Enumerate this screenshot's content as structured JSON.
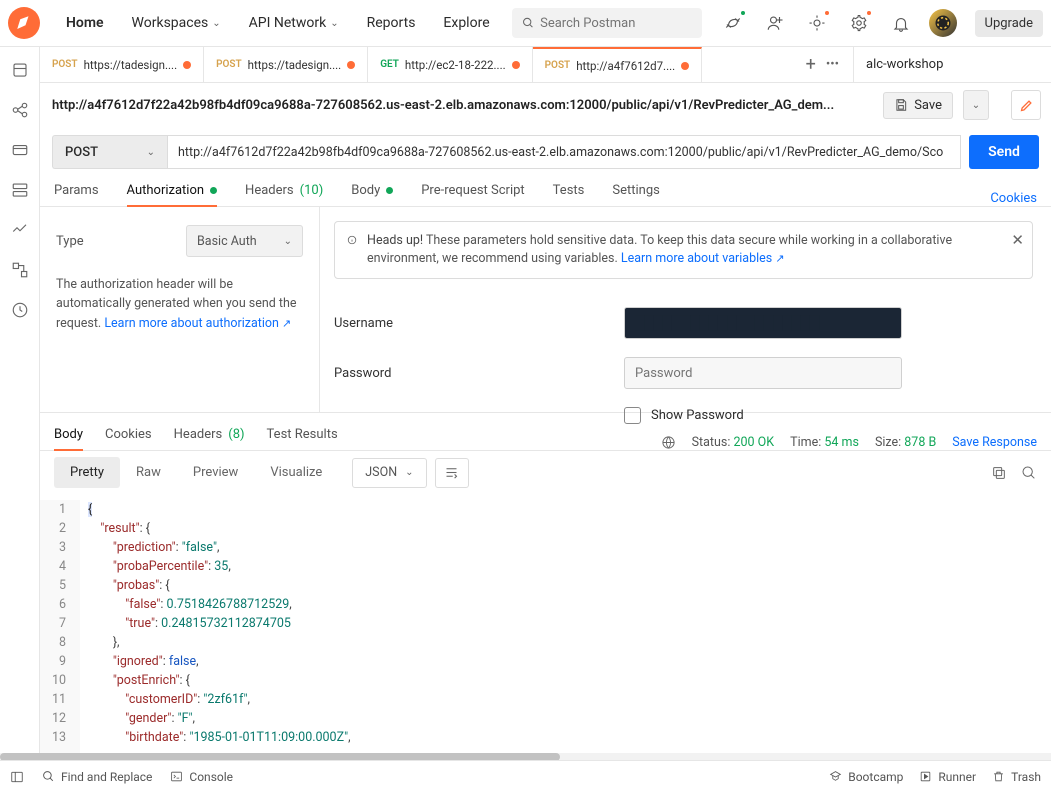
{
  "nav": {
    "home": "Home",
    "workspaces": "Workspaces",
    "apinetwork": "API Network",
    "reports": "Reports",
    "explore": "Explore",
    "search_placeholder": "Search Postman",
    "upgrade": "Upgrade"
  },
  "tabs": [
    {
      "method": "POST",
      "title": "https://tadesign....",
      "dirty": true
    },
    {
      "method": "POST",
      "title": "https://tadesign....",
      "dirty": true
    },
    {
      "method": "GET",
      "title": "http://ec2-18-222....",
      "dirty": true
    },
    {
      "method": "POST",
      "title": "http://a4f7612d7....",
      "dirty": true,
      "active": true
    }
  ],
  "environment": "alc-workshop",
  "request": {
    "breadcrumb": "http://a4f7612d7f22a42b98fb4df09ca9688a-727608562.us-east-2.elb.amazonaws.com:12000/public/api/v1/RevPredicter_AG_dem...",
    "method": "POST",
    "url": "http://a4f7612d7f22a42b98fb4df09ca9688a-727608562.us-east-2.elb.amazonaws.com:12000/public/api/v1/RevPredicter_AG_demo/Sco",
    "save": "Save",
    "send": "Send"
  },
  "reqtabs": {
    "params": "Params",
    "authorization": "Authorization",
    "headers": "Headers",
    "headers_count": "(10)",
    "body": "Body",
    "prereq": "Pre-request Script",
    "tests": "Tests",
    "settings": "Settings",
    "cookies": "Cookies"
  },
  "auth": {
    "type_label": "Type",
    "type_value": "Basic Auth",
    "help_text": "The authorization header will be automatically generated when you send the request. ",
    "help_link": "Learn more about authorization",
    "notice_head": "Heads up! ",
    "notice_body": "These parameters hold sensitive data. To keep this data secure while working in a collaborative environment, we recommend using variables. ",
    "notice_link": "Learn more about variables",
    "username_label": "Username",
    "password_label": "Password",
    "password_placeholder": "Password",
    "show_password": "Show Password"
  },
  "resp": {
    "body": "Body",
    "cookies": "Cookies",
    "headers": "Headers",
    "headers_count": "(8)",
    "test_results": "Test Results",
    "status_label": "Status:",
    "status_value": "200 OK",
    "time_label": "Time:",
    "time_value": "54 ms",
    "size_label": "Size:",
    "size_value": "878 B",
    "save_response": "Save Response"
  },
  "format": {
    "pretty": "Pretty",
    "raw": "Raw",
    "preview": "Preview",
    "visualize": "Visualize",
    "lang": "JSON"
  },
  "code_lines": [
    1,
    2,
    3,
    4,
    5,
    6,
    7,
    8,
    9,
    10,
    11,
    12,
    13
  ],
  "json_body": {
    "result_key": "\"result\"",
    "prediction_key": "\"prediction\"",
    "prediction_val": "\"false\"",
    "probaPercentile_key": "\"probaPercentile\"",
    "probaPercentile_val": "35",
    "probas_key": "\"probas\"",
    "false_key": "\"false\"",
    "false_val": "0.7518426788712529",
    "true_key": "\"true\"",
    "true_val": "0.24815732112874705",
    "ignored_key": "\"ignored\"",
    "ignored_val": "false",
    "postEnrich_key": "\"postEnrich\"",
    "customerID_key": "\"customerID\"",
    "customerID_val": "\"2zf61f\"",
    "gender_key": "\"gender\"",
    "gender_val": "\"F\"",
    "birthdate_key": "\"birthdate\"",
    "birthdate_val": "\"1985-01-01T11:09:00.000Z\""
  },
  "footer": {
    "find": "Find and Replace",
    "console": "Console",
    "bootcamp": "Bootcamp",
    "runner": "Runner",
    "trash": "Trash"
  }
}
